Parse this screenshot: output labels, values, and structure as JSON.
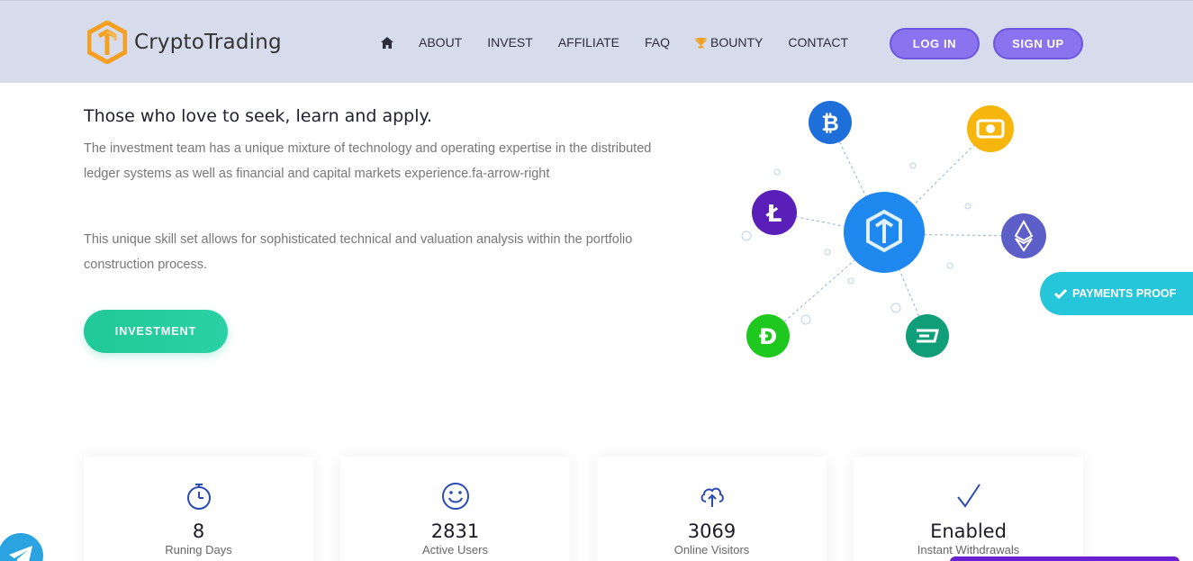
{
  "brand": {
    "name": "CryptoTrading"
  },
  "nav": {
    "home_icon": "home-icon",
    "items": [
      "ABOUT",
      "INVEST",
      "AFFILIATE",
      "FAQ",
      "BOUNTY",
      "CONTACT"
    ],
    "bounty_icon": "trophy-icon"
  },
  "auth": {
    "login": "LOG IN",
    "signup": "SIGN UP"
  },
  "hero": {
    "headline": "Those who love to seek, learn and apply.",
    "para1": "The investment team has a unique mixture of technology and operating expertise in the distributed ledger systems as well as financial and capital markets experience.fa-arrow-right",
    "para2": "This unique skill set allows for sophisticated technical and valuation analysis within the portfolio construction process.",
    "cta": "INVESTMENT"
  },
  "graphic": {
    "coins": [
      "bitcoin-icon",
      "bitcoin-cash-icon",
      "litecoin-icon",
      "ethereum-icon",
      "dogecoin-icon",
      "dash-icon"
    ],
    "center": "cryptotrading-logo"
  },
  "payments_proof": {
    "label": "PAYMENTS PROOF"
  },
  "stats": [
    {
      "value": "8",
      "label": "Runing Days",
      "icon": "stopwatch-icon"
    },
    {
      "value": "2831",
      "label": "Active Users",
      "icon": "smile-icon"
    },
    {
      "value": "3069",
      "label": "Online Visitors",
      "icon": "cloud-upload-icon"
    },
    {
      "value": "Enabled",
      "label": "Instant Withdrawals",
      "icon": "checkmark-icon"
    }
  ],
  "colors": {
    "header_bg": "#d6dcec",
    "accent_purple": "#8a73ee",
    "accent_green": "#20c997",
    "accent_cyan": "#26c6da",
    "brand_orange": "#f5a023",
    "stat_icon": "#2a4bb3"
  }
}
